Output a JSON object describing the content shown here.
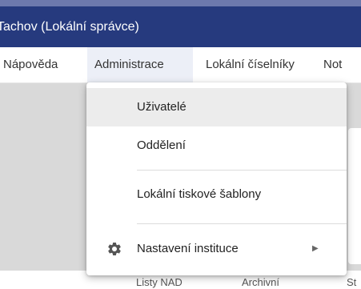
{
  "title": "Tachov (Lokální správce)",
  "menubar": {
    "items": [
      {
        "label": "Nápověda"
      },
      {
        "label": "Administrace",
        "active": true
      },
      {
        "label": "Lokální číselníky"
      },
      {
        "label": "Not"
      }
    ]
  },
  "dropdown": {
    "items": [
      {
        "label": "Uživatelé",
        "highlighted": true
      },
      {
        "label": "Oddělení"
      },
      {
        "label": "Lokální tiskové šablony"
      },
      {
        "label": "Nastavení instituce",
        "icon": "gear-icon",
        "has_submenu": true
      }
    ]
  },
  "footer": {
    "labels": [
      "Listy NAD",
      "Archivní",
      "St"
    ]
  },
  "colors": {
    "titlebar": "#263a7e",
    "accent": "#6d79ad",
    "active_menu": "#eceff7",
    "highlight": "#ececec",
    "backdrop": "#d9d9d9"
  }
}
